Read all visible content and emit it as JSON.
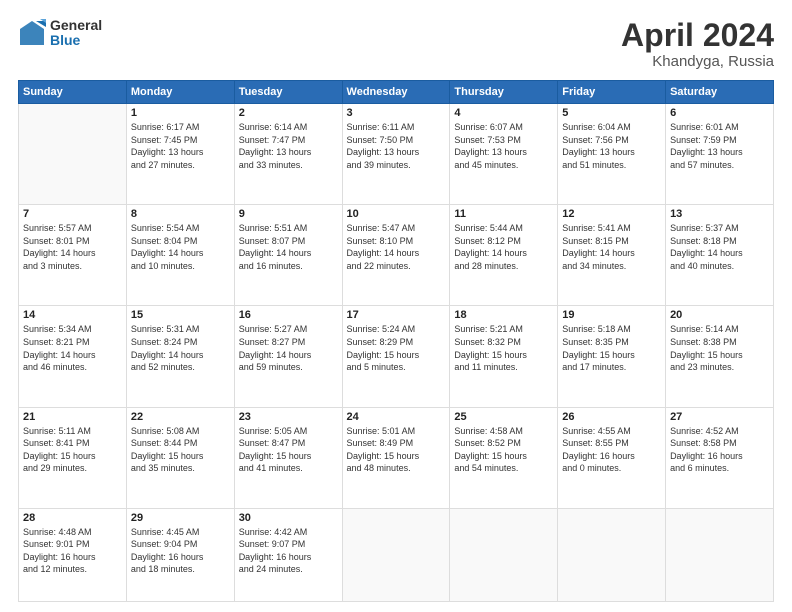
{
  "header": {
    "logo": {
      "general": "General",
      "blue": "Blue"
    },
    "title": "April 2024",
    "location": "Khandyga, Russia"
  },
  "calendar": {
    "days_of_week": [
      "Sunday",
      "Monday",
      "Tuesday",
      "Wednesday",
      "Thursday",
      "Friday",
      "Saturday"
    ],
    "weeks": [
      [
        {
          "day": "",
          "info": ""
        },
        {
          "day": "1",
          "info": "Sunrise: 6:17 AM\nSunset: 7:45 PM\nDaylight: 13 hours\nand 27 minutes."
        },
        {
          "day": "2",
          "info": "Sunrise: 6:14 AM\nSunset: 7:47 PM\nDaylight: 13 hours\nand 33 minutes."
        },
        {
          "day": "3",
          "info": "Sunrise: 6:11 AM\nSunset: 7:50 PM\nDaylight: 13 hours\nand 39 minutes."
        },
        {
          "day": "4",
          "info": "Sunrise: 6:07 AM\nSunset: 7:53 PM\nDaylight: 13 hours\nand 45 minutes."
        },
        {
          "day": "5",
          "info": "Sunrise: 6:04 AM\nSunset: 7:56 PM\nDaylight: 13 hours\nand 51 minutes."
        },
        {
          "day": "6",
          "info": "Sunrise: 6:01 AM\nSunset: 7:59 PM\nDaylight: 13 hours\nand 57 minutes."
        }
      ],
      [
        {
          "day": "7",
          "info": "Sunrise: 5:57 AM\nSunset: 8:01 PM\nDaylight: 14 hours\nand 3 minutes."
        },
        {
          "day": "8",
          "info": "Sunrise: 5:54 AM\nSunset: 8:04 PM\nDaylight: 14 hours\nand 10 minutes."
        },
        {
          "day": "9",
          "info": "Sunrise: 5:51 AM\nSunset: 8:07 PM\nDaylight: 14 hours\nand 16 minutes."
        },
        {
          "day": "10",
          "info": "Sunrise: 5:47 AM\nSunset: 8:10 PM\nDaylight: 14 hours\nand 22 minutes."
        },
        {
          "day": "11",
          "info": "Sunrise: 5:44 AM\nSunset: 8:12 PM\nDaylight: 14 hours\nand 28 minutes."
        },
        {
          "day": "12",
          "info": "Sunrise: 5:41 AM\nSunset: 8:15 PM\nDaylight: 14 hours\nand 34 minutes."
        },
        {
          "day": "13",
          "info": "Sunrise: 5:37 AM\nSunset: 8:18 PM\nDaylight: 14 hours\nand 40 minutes."
        }
      ],
      [
        {
          "day": "14",
          "info": "Sunrise: 5:34 AM\nSunset: 8:21 PM\nDaylight: 14 hours\nand 46 minutes."
        },
        {
          "day": "15",
          "info": "Sunrise: 5:31 AM\nSunset: 8:24 PM\nDaylight: 14 hours\nand 52 minutes."
        },
        {
          "day": "16",
          "info": "Sunrise: 5:27 AM\nSunset: 8:27 PM\nDaylight: 14 hours\nand 59 minutes."
        },
        {
          "day": "17",
          "info": "Sunrise: 5:24 AM\nSunset: 8:29 PM\nDaylight: 15 hours\nand 5 minutes."
        },
        {
          "day": "18",
          "info": "Sunrise: 5:21 AM\nSunset: 8:32 PM\nDaylight: 15 hours\nand 11 minutes."
        },
        {
          "day": "19",
          "info": "Sunrise: 5:18 AM\nSunset: 8:35 PM\nDaylight: 15 hours\nand 17 minutes."
        },
        {
          "day": "20",
          "info": "Sunrise: 5:14 AM\nSunset: 8:38 PM\nDaylight: 15 hours\nand 23 minutes."
        }
      ],
      [
        {
          "day": "21",
          "info": "Sunrise: 5:11 AM\nSunset: 8:41 PM\nDaylight: 15 hours\nand 29 minutes."
        },
        {
          "day": "22",
          "info": "Sunrise: 5:08 AM\nSunset: 8:44 PM\nDaylight: 15 hours\nand 35 minutes."
        },
        {
          "day": "23",
          "info": "Sunrise: 5:05 AM\nSunset: 8:47 PM\nDaylight: 15 hours\nand 41 minutes."
        },
        {
          "day": "24",
          "info": "Sunrise: 5:01 AM\nSunset: 8:49 PM\nDaylight: 15 hours\nand 48 minutes."
        },
        {
          "day": "25",
          "info": "Sunrise: 4:58 AM\nSunset: 8:52 PM\nDaylight: 15 hours\nand 54 minutes."
        },
        {
          "day": "26",
          "info": "Sunrise: 4:55 AM\nSunset: 8:55 PM\nDaylight: 16 hours\nand 0 minutes."
        },
        {
          "day": "27",
          "info": "Sunrise: 4:52 AM\nSunset: 8:58 PM\nDaylight: 16 hours\nand 6 minutes."
        }
      ],
      [
        {
          "day": "28",
          "info": "Sunrise: 4:48 AM\nSunset: 9:01 PM\nDaylight: 16 hours\nand 12 minutes."
        },
        {
          "day": "29",
          "info": "Sunrise: 4:45 AM\nSunset: 9:04 PM\nDaylight: 16 hours\nand 18 minutes."
        },
        {
          "day": "30",
          "info": "Sunrise: 4:42 AM\nSunset: 9:07 PM\nDaylight: 16 hours\nand 24 minutes."
        },
        {
          "day": "",
          "info": ""
        },
        {
          "day": "",
          "info": ""
        },
        {
          "day": "",
          "info": ""
        },
        {
          "day": "",
          "info": ""
        }
      ]
    ]
  }
}
